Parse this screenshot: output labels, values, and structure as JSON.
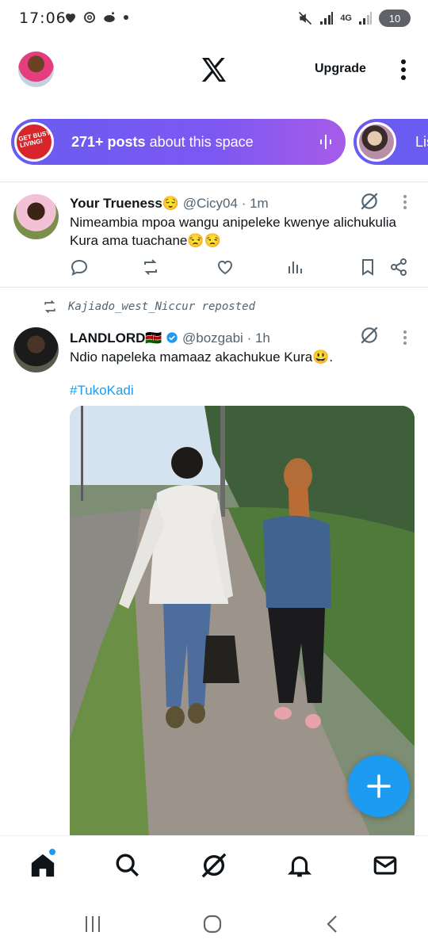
{
  "status_bar": {
    "time": "17:06",
    "network_label": "4G",
    "battery": "10"
  },
  "header": {
    "upgrade_label": "Upgrade",
    "logo_icon": "x-logo-icon",
    "menu_icon": "more-vertical-icon"
  },
  "spaces": {
    "pill_bold": "271+ posts",
    "pill_text": " about this space",
    "logo_text": "GET BUSY LIVING!",
    "second_label": "Lis"
  },
  "posts": [
    {
      "name": "Your Trueness😌",
      "handle": "@Cicy04",
      "time": "· 1m",
      "text": "Nimeambia mpoa wangu anipeleke kwenye alichukulia Kura ama tuachane😒😒"
    },
    {
      "repost_by": "Kajiado_west_Niccur reposted",
      "name": "LANDLORD🇰🇪",
      "handle": "@bozgabi",
      "time": "· 1h",
      "verified": true,
      "text": "Ndio napeleka mamaaz akachukue Kura😃.",
      "hashtag": "#TukoKadi"
    }
  ],
  "colors": {
    "accent": "#1d9bf0",
    "space_gradient_start": "#6a5cf0",
    "space_gradient_end": "#a65ce8",
    "secondary_text": "#536471"
  },
  "bottom_nav": [
    "home-icon",
    "search-icon",
    "grok-icon",
    "notifications-icon",
    "messages-icon"
  ]
}
